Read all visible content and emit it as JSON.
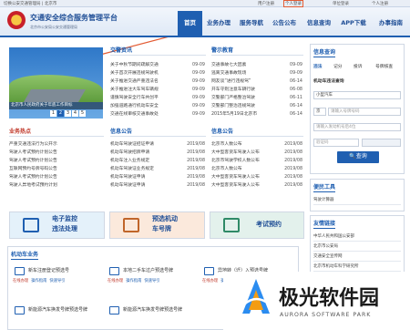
{
  "topbar": {
    "left_text": "切换公安交通管理局 | 北京市",
    "right_links": [
      "用户注册",
      "个人登录",
      "单位登录",
      "个人注册"
    ]
  },
  "header": {
    "title": "交通安全综合服务管理平台",
    "subtitle": "北京市公安局公安交通管理局",
    "nav": [
      "首页",
      "业务办理",
      "服务导航",
      "公告公布",
      "信息查询",
      "APP下载",
      "办事指南"
    ]
  },
  "banner": {
    "caption": "北京市人民政府关于年底工作目标",
    "pages": [
      "1",
      "2",
      "3",
      "4",
      "5"
    ],
    "active_page": "2"
  },
  "sections": {
    "traffic_news": {
      "title": "交警资讯",
      "items": [
        {
          "t": "关于中秋节期间疏解交通",
          "d": "09-09"
        },
        {
          "t": "关于首次开展违规驾驶机",
          "d": "09-09"
        },
        {
          "t": "关于推进交通严重违法名",
          "d": "09-09"
        },
        {
          "t": "关于推进注大车驾车辆规",
          "d": "09-09"
        },
        {
          "t": "谨慎驾驶安全行车共创平",
          "d": "09-09"
        },
        {
          "t": "加强道路通行机动车安全",
          "d": "09-09"
        },
        {
          "t": "交通在线审核交通事故处",
          "d": "09-09"
        }
      ]
    },
    "warning_edu": {
      "title": "警示教育",
      "items": [
        {
          "t": "交通事故七大因素",
          "d": "09-09"
        },
        {
          "t": "逃离交通事故现场",
          "d": "09-09"
        },
        {
          "t": "网友谈“进行违规驾”",
          "d": "06-14"
        },
        {
          "t": "开车守则注意车辆行驶",
          "d": "06-08"
        },
        {
          "t": "交警部门严格整治驾驶",
          "d": "06-11"
        },
        {
          "t": "交警部门整治违规驾驶",
          "d": "06-14"
        },
        {
          "t": "2015年5月19日北京市",
          "d": "06-14"
        }
      ]
    },
    "hot_business": {
      "title": "业务热点",
      "items": [
        "严重交通违法行为公开示",
        "驾驶人考试预约计划公告",
        "驾驶人考试预约计划公告",
        "互联网预约号牌号码公告",
        "驾驶人考试预约计划公告",
        "驾驶人异地考试预约计划"
      ]
    },
    "info_notice_1": {
      "title": "信息公告",
      "items": [
        {
          "t": "机动车驾驶证招证申请",
          "d": "2019/08"
        },
        {
          "t": "机动车驾驶招牌申请",
          "d": "2019/08"
        },
        {
          "t": "机动车注入业务规定",
          "d": "2019/08"
        },
        {
          "t": "机动车驾驶证业务规定",
          "d": "2019/08"
        },
        {
          "t": "机动车驾驶证申请",
          "d": "2019/08"
        },
        {
          "t": "机动车驾驶证申请",
          "d": "2019/08"
        }
      ]
    },
    "info_notice_2": {
      "title": "信息公告",
      "items": [
        {
          "t": "北京市人数公布",
          "d": "2019/08"
        },
        {
          "t": "大中型客货车驾驶人公布",
          "d": "2019/08"
        },
        {
          "t": "北京市驾驶学校人数公布",
          "d": "2019/08"
        },
        {
          "t": "北京市人数公布",
          "d": "2019/08"
        },
        {
          "t": "大中型客货车驾驶人公布",
          "d": "2019/08"
        },
        {
          "t": "大中型客货车驾驶人公布",
          "d": "2019/08"
        }
      ]
    }
  },
  "services": [
    {
      "label1": "电子监控",
      "label2": "违法处理"
    },
    {
      "label1": "预选机动",
      "label2": "车号牌"
    },
    {
      "label1": "考试预约",
      "label2": ""
    }
  ],
  "vehicle_business": {
    "title": "机动车业务",
    "rows": [
      [
        {
          "name": "新车注册登记预选号",
          "acts": [
            "在线办理",
            "操作指南",
            "快速导引"
          ]
        },
        {
          "name": "本地二手车过户预选号牌",
          "acts": [
            "在线办理",
            "操作指南",
            "快速导引"
          ]
        },
        {
          "name": "异地转（迁）入预选号牌",
          "acts": [
            "在线办理",
            "操作指南",
            "快速导引"
          ]
        }
      ],
      [
        {
          "name": "新能源汽车换发号牌预选号牌",
          "acts": []
        },
        {
          "name": "新能源汽车换发号牌预选号牌",
          "acts": []
        },
        {
          "name": "",
          "acts": []
        }
      ]
    ]
  },
  "right_panel": {
    "query_title": "信息查询",
    "tabs": [
      "违法",
      "记分",
      "投诉",
      "号牌核查"
    ],
    "subtitle": "机动车违法查询",
    "vehicle_type": "小型汽车",
    "plate_prefix": "京",
    "plate_placeholder": "请输入号牌号码",
    "vin_placeholder": "请输入发动机号后4位",
    "code_placeholder": "验证码",
    "query_button": "查询",
    "convenience_title": "便民工具",
    "convenience_items": [
      "驾驶计算器"
    ],
    "links_title": "友情链接",
    "links": [
      "中华人民共和国公安部",
      "北京市公安局",
      "交通安全宣传网",
      "北京市机动车科学研究所",
      "交通安全宣传网"
    ]
  },
  "watermark": {
    "cn": "极光软件园",
    "en": "AURORA SOFTWARE PARK"
  },
  "colors": {
    "primary": "#1f5fb1",
    "header_bg": "#e6eef8",
    "highlight": "#e35b33"
  }
}
